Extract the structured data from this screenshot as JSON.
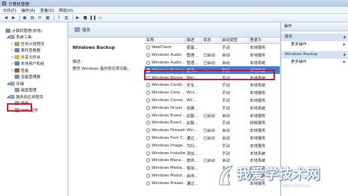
{
  "window": {
    "title": "计算机管理"
  },
  "menu": [
    "文件(F)",
    "操作(A)",
    "查看(V)",
    "帮助(H)"
  ],
  "toolbar": [
    "back-icon",
    "forward-icon",
    "up-icon",
    "show-hide-icon",
    "refresh-icon",
    "export-icon",
    "help-icon",
    "properties-icon",
    "play-icon",
    "stop-icon",
    "pause-icon",
    "restart-icon"
  ],
  "tree": [
    {
      "label": "计算机管理(本地)",
      "level": 0,
      "twist": "",
      "icon": "#7f8fa6"
    },
    {
      "label": "系统工具",
      "level": 1,
      "twist": "◢",
      "icon": "#8fa9c8"
    },
    {
      "label": "任务计划程序",
      "level": 2,
      "twist": "▷",
      "icon": "#b79b5a"
    },
    {
      "label": "事件查看器",
      "level": 2,
      "twist": "▷",
      "icon": "#6d8bb3"
    },
    {
      "label": "共享文件夹",
      "level": 2,
      "twist": "▷",
      "icon": "#e0b94a"
    },
    {
      "label": "本地用户和组",
      "level": 2,
      "twist": "▷",
      "icon": "#5d89b6"
    },
    {
      "label": "性能",
      "level": 2,
      "twist": "▷",
      "icon": "#b04d4d"
    },
    {
      "label": "设备管理器",
      "level": 2,
      "twist": "",
      "icon": "#7791b6"
    },
    {
      "label": "存储",
      "level": 1,
      "twist": "◢",
      "icon": "#8fa9c8"
    },
    {
      "label": "磁盘管理",
      "level": 2,
      "twist": "",
      "icon": "#8a9ab0"
    },
    {
      "label": "服务和应用程序",
      "level": 1,
      "twist": "◢",
      "icon": "#8fa9c8"
    },
    {
      "label": "服务",
      "level": 2,
      "twist": "",
      "icon": "#90a3bd"
    },
    {
      "label": "WMI 控件",
      "level": 2,
      "twist": "",
      "icon": "#90a3bd"
    }
  ],
  "header": {
    "title": "服务"
  },
  "detail": {
    "name": "Windows Backup",
    "desc_label": "描述:",
    "desc_text": "提供 Windows 备份和还原功能。"
  },
  "columns": [
    "名称",
    "描述",
    "状态",
    "启动类型",
    "登录为"
  ],
  "services": [
    {
      "name": "WebClient",
      "desc": "使基...",
      "status": "",
      "start": "手动",
      "logon": "本地服务"
    },
    {
      "name": "Windows Audio",
      "desc": "管理...",
      "status": "已启动",
      "start": "自动",
      "logon": "本地服务"
    },
    {
      "name": "Windows Audio ...",
      "desc": "管理...",
      "status": "已启动",
      "start": "自动",
      "logon": "本地系统"
    },
    {
      "name": "Windows Backup",
      "desc": "提供...",
      "status": "",
      "start": "禁用",
      "logon": "本地系统",
      "selected": true
    },
    {
      "name": "Windows Biome...",
      "desc": "Win...",
      "status": "",
      "start": "手动",
      "logon": "本地系统"
    },
    {
      "name": "Windows CardS...",
      "desc": "安全...",
      "status": "",
      "start": "手动",
      "logon": "本地系统"
    },
    {
      "name": "Windows Color ...",
      "desc": "Wcs...",
      "status": "",
      "start": "手动",
      "logon": "本地服务"
    },
    {
      "name": "Windows Conne...",
      "desc": "WC...",
      "status": "",
      "start": "手动",
      "logon": "本地服务"
    },
    {
      "name": "Windows Driver ...",
      "desc": "创建...",
      "status": "",
      "start": "手动",
      "logon": "本地系统"
    },
    {
      "name": "Windows Event ...",
      "desc": "此服...",
      "status": "已启动",
      "start": "自动",
      "logon": "本地服务"
    },
    {
      "name": "Windows Event ...",
      "desc": "此服...",
      "status": "",
      "start": "手动",
      "logon": "网络服务"
    },
    {
      "name": "Windows Firewall",
      "desc": "Win...",
      "status": "已启动",
      "start": "自动",
      "logon": "本地服务"
    },
    {
      "name": "Windows Font C...",
      "desc": "通过...",
      "status": "已启动",
      "start": "自动",
      "logon": "本地服务"
    },
    {
      "name": "Windows Image...",
      "desc": "为扫...",
      "status": "",
      "start": "手动",
      "logon": "本地服务"
    },
    {
      "name": "Windows Installer",
      "desc": "添加...",
      "status": "",
      "start": "手动",
      "logon": "本地系统"
    },
    {
      "name": "Windows Mana...",
      "desc": "提供...",
      "status": "已启动",
      "start": "自动",
      "logon": "本地系统"
    },
    {
      "name": "Windows Media...",
      "desc": "使用...",
      "status": "",
      "start": "手动",
      "logon": "网络服务"
    },
    {
      "name": "Windows Modul...",
      "desc": "启用...",
      "status": "",
      "start": "手动",
      "logon": "本地系统"
    },
    {
      "name": "Windows Presen...",
      "desc": "通过...",
      "status": "",
      "start": "手动",
      "logon": "本地服务"
    }
  ],
  "actions": {
    "title": "操作",
    "sections": [
      {
        "label": "服务",
        "more": "更多操作"
      },
      {
        "label": "Windows Backup",
        "more": "更多操作"
      }
    ]
  },
  "watermark": {
    "text": "我爱学技术网",
    "sub": "www.5ijsw.cn"
  }
}
